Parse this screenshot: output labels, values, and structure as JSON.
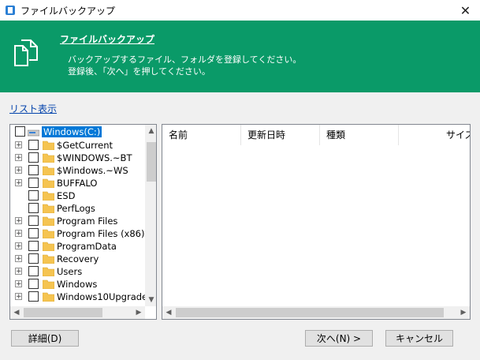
{
  "window": {
    "title": "ファイルバックアップ",
    "close_glyph": "✕"
  },
  "banner": {
    "title": "ファイルバックアップ",
    "desc_line1": "バックアップするファイル、フォルダを登録してください。",
    "desc_line2": "登録後、「次へ」を押してください。"
  },
  "list_view_link": "リスト表示",
  "tree": {
    "root": "Windows(C:)",
    "items": [
      {
        "label": "$GetCurrent",
        "expandable": true
      },
      {
        "label": "$WINDOWS.~BT",
        "expandable": true
      },
      {
        "label": "$Windows.~WS",
        "expandable": true
      },
      {
        "label": "BUFFALO",
        "expandable": true
      },
      {
        "label": "ESD",
        "expandable": false
      },
      {
        "label": "PerfLogs",
        "expandable": false
      },
      {
        "label": "Program Files",
        "expandable": true
      },
      {
        "label": "Program Files (x86)",
        "expandable": true
      },
      {
        "label": "ProgramData",
        "expandable": true
      },
      {
        "label": "Recovery",
        "expandable": true
      },
      {
        "label": "Users",
        "expandable": true
      },
      {
        "label": "Windows",
        "expandable": true
      },
      {
        "label": "Windows10Upgrade",
        "expandable": true
      }
    ]
  },
  "list": {
    "columns": [
      "名前",
      "更新日時",
      "種類",
      "サイズ"
    ]
  },
  "buttons": {
    "details": "詳細(D)",
    "next": "次へ(N) >",
    "cancel": "キャンセル"
  },
  "colors": {
    "banner": "#0a9a68",
    "selection": "#0078d7",
    "link": "#0645ad"
  }
}
